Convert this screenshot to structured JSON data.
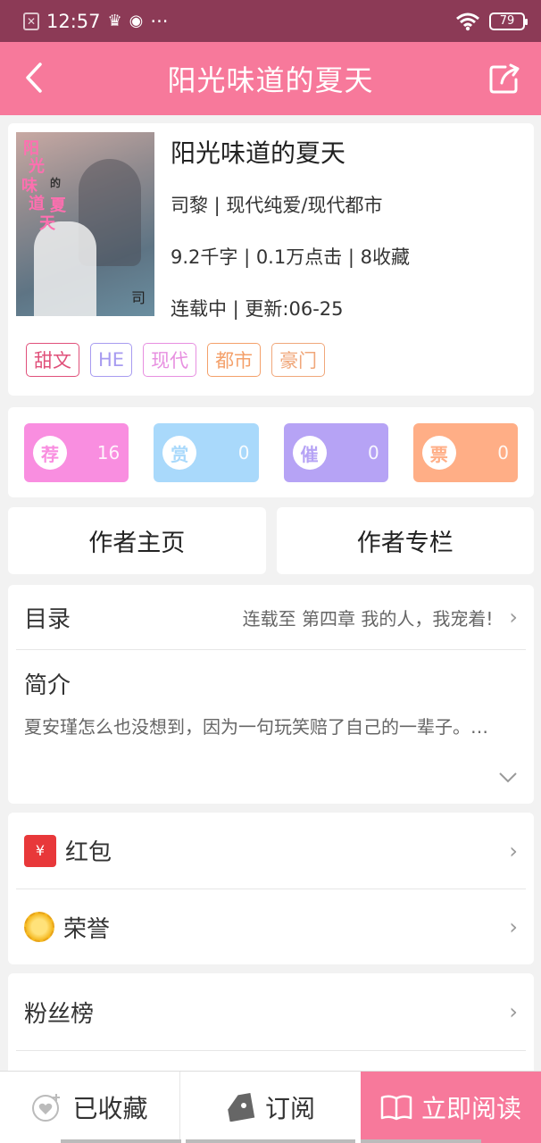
{
  "status": {
    "time": "12:57",
    "extra": "···",
    "battery": "79"
  },
  "appbar": {
    "title": "阳光味道的夏天"
  },
  "book": {
    "title": "阳光味道的夏天",
    "author_line": "司黎 | 现代纯爱/现代都市",
    "stats_line": "9.2千字 | 0.1万点击 | 8收藏",
    "status_line": "连载中 | 更新:06-25",
    "cover_text": [
      "阳",
      "光",
      "味",
      "道",
      "的",
      "夏",
      "天"
    ],
    "tags": [
      {
        "label": "甜文",
        "color": "#e0507a"
      },
      {
        "label": "HE",
        "color": "#a79bf0"
      },
      {
        "label": "现代",
        "color": "#e78fe0"
      },
      {
        "label": "都市",
        "color": "#f4a06a"
      },
      {
        "label": "豪门",
        "color": "#f0a77a"
      }
    ]
  },
  "actions": [
    {
      "badge": "荐",
      "count": "16",
      "color": "#f98ee0"
    },
    {
      "badge": "赏",
      "count": "0",
      "color": "#a9d9fb"
    },
    {
      "badge": "催",
      "count": "0",
      "color": "#b6a3f5"
    },
    {
      "badge": "票",
      "count": "0",
      "color": "#ffae86"
    }
  ],
  "authors": {
    "homepage": "作者主页",
    "column": "作者专栏"
  },
  "catalog": {
    "label": "目录",
    "latest": "连载至 第四章  我的人，我宠着!"
  },
  "intro": {
    "label": "简介",
    "text": "夏安瑾怎么也没想到，因为一句玩笑赔了自己的一辈子。…"
  },
  "misc": {
    "redpacket": "红包",
    "honor": "荣誉",
    "redpacket_icon": "¥"
  },
  "fans": {
    "label": "粉丝榜"
  },
  "bottom": {
    "favorited": "已收藏",
    "subscribe": "订阅",
    "read": "立即阅读"
  },
  "colors": {
    "brand": "#f7799b",
    "statusbar": "#8c3a56"
  }
}
